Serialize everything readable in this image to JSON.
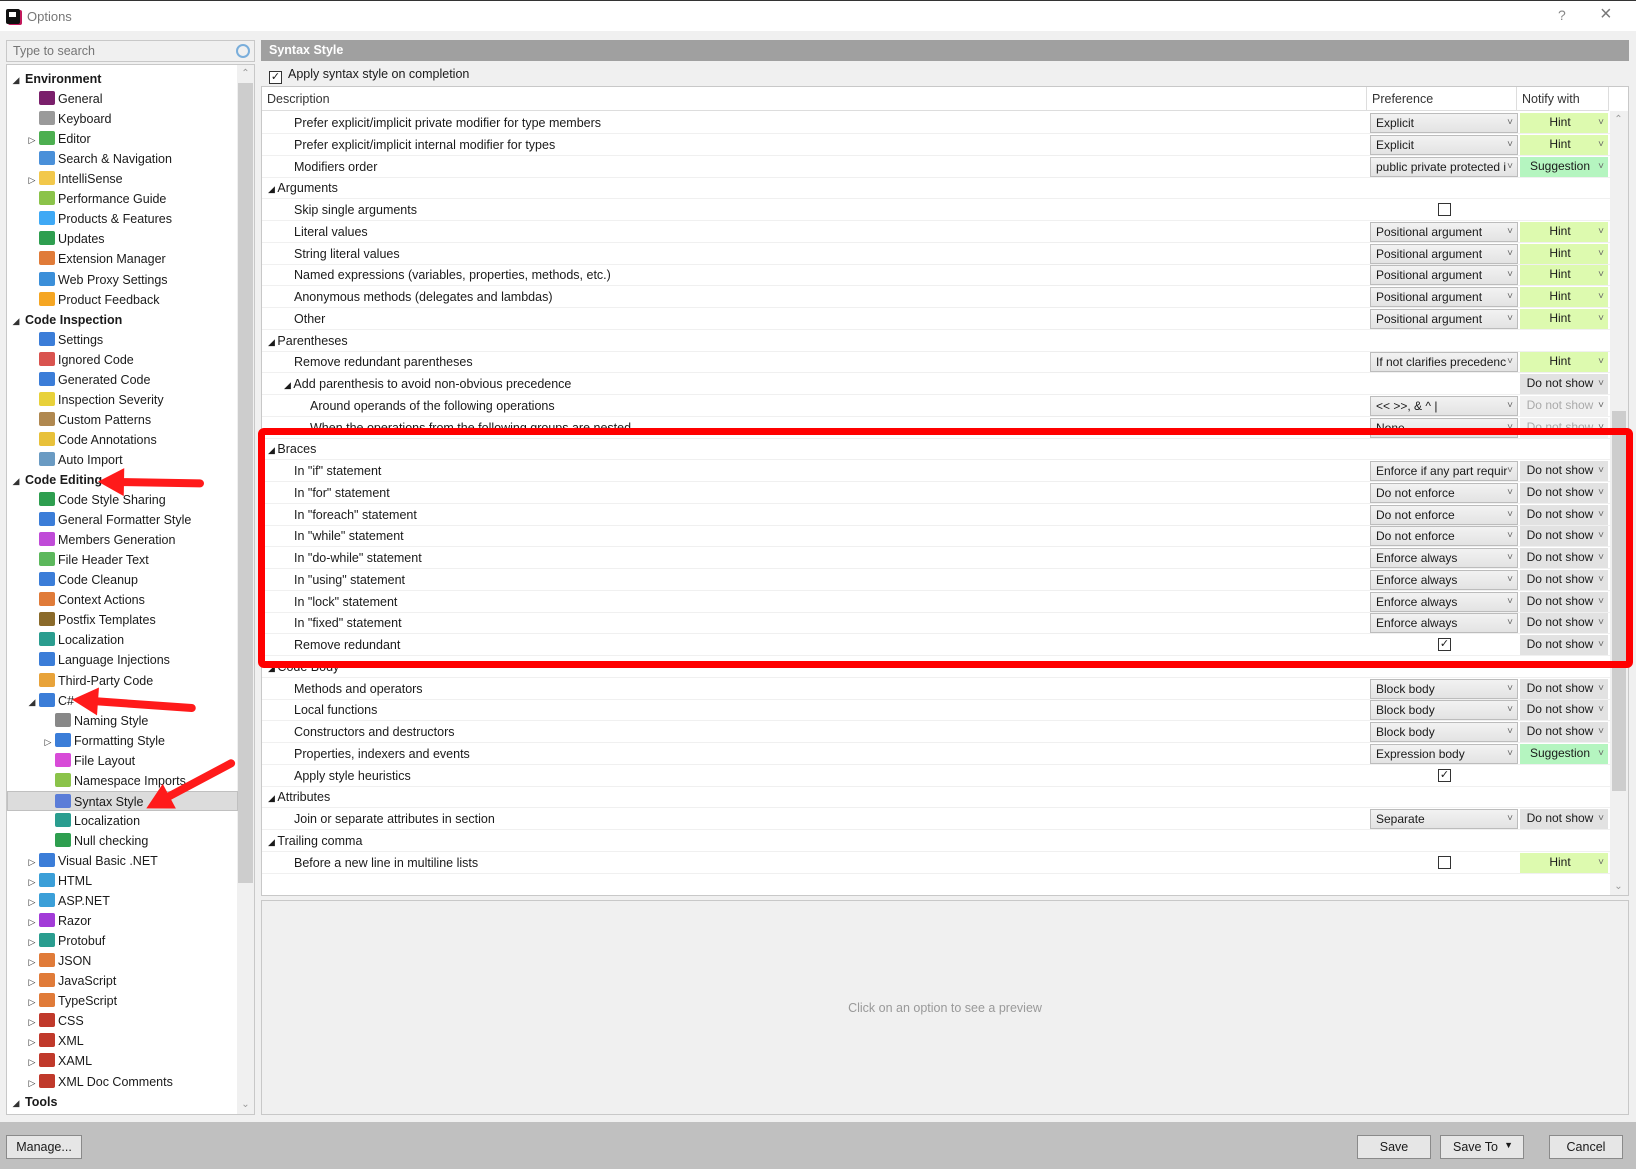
{
  "window": {
    "title": "Options",
    "help_label": "?",
    "close_label": "×"
  },
  "search": {
    "placeholder": "Type to search"
  },
  "tree": [
    {
      "label": "Environment",
      "level": 0,
      "category": true,
      "expander": "expanded"
    },
    {
      "label": "General",
      "level": 1,
      "icon": "resharper-icon",
      "color": "#7a1f6b"
    },
    {
      "label": "Keyboard",
      "level": 1,
      "icon": "keyboard-icon",
      "color": "#9a9a9a"
    },
    {
      "label": "Editor",
      "level": 1,
      "icon": "pencil-icon",
      "color": "#4caf50",
      "expander": "collapsed"
    },
    {
      "label": "Search & Navigation",
      "level": 1,
      "icon": "magnifier-icon",
      "color": "#4a90d9"
    },
    {
      "label": "IntelliSense",
      "level": 1,
      "icon": "lightbulb-icon",
      "color": "#f2c84b",
      "expander": "collapsed"
    },
    {
      "label": "Performance Guide",
      "level": 1,
      "icon": "snail-icon",
      "color": "#8bc34a"
    },
    {
      "label": "Products & Features",
      "level": 1,
      "icon": "blocks-icon",
      "color": "#3fa9f5"
    },
    {
      "label": "Updates",
      "level": 1,
      "icon": "download-icon",
      "color": "#2e9e4f"
    },
    {
      "label": "Extension Manager",
      "level": 1,
      "icon": "extension-icon",
      "color": "#e07b39"
    },
    {
      "label": "Web Proxy Settings",
      "level": 1,
      "icon": "globe-plug-icon",
      "color": "#3b8fd9"
    },
    {
      "label": "Product Feedback",
      "level": 1,
      "icon": "envelope-icon",
      "color": "#f5a623"
    },
    {
      "label": "Code Inspection",
      "level": 0,
      "category": true,
      "expander": "expanded"
    },
    {
      "label": "Settings",
      "level": 1,
      "icon": "inspector-icon",
      "color": "#3b7dd8"
    },
    {
      "label": "Ignored Code",
      "level": 1,
      "icon": "ignored-icon",
      "color": "#d9534f"
    },
    {
      "label": "Generated Code",
      "level": 1,
      "icon": "generated-icon",
      "color": "#3b7dd8"
    },
    {
      "label": "Inspection Severity",
      "level": 1,
      "icon": "severity-icon",
      "color": "#e8d13a"
    },
    {
      "label": "Custom Patterns",
      "level": 1,
      "icon": "patterns-icon",
      "color": "#b08850"
    },
    {
      "label": "Code Annotations",
      "level": 1,
      "icon": "annotations-icon",
      "color": "#e8c13a"
    },
    {
      "label": "Auto Import",
      "level": 1,
      "icon": "funnel-icon",
      "color": "#6a9bc3"
    },
    {
      "label": "Code Editing",
      "level": 0,
      "category": true,
      "expander": "expanded"
    },
    {
      "label": "Code Style Sharing",
      "level": 1,
      "icon": "share-icon",
      "color": "#2e9e4f"
    },
    {
      "label": "General Formatter Style",
      "level": 1,
      "icon": "formatter-icon",
      "color": "#3b7dd8"
    },
    {
      "label": "Members Generation",
      "level": 1,
      "icon": "members-icon",
      "color": "#c04bd8"
    },
    {
      "label": "File Header Text",
      "level": 1,
      "icon": "file-header-icon",
      "color": "#5cb85c"
    },
    {
      "label": "Code Cleanup",
      "level": 1,
      "icon": "broom-icon",
      "color": "#3b7dd8"
    },
    {
      "label": "Context Actions",
      "level": 1,
      "icon": "hammer-icon",
      "color": "#e07b39"
    },
    {
      "label": "Postfix Templates",
      "level": 1,
      "icon": "postfix-icon",
      "color": "#8a6a2a"
    },
    {
      "label": "Localization",
      "level": 1,
      "icon": "localization-icon",
      "color": "#2a9d8f"
    },
    {
      "label": "Language Injections",
      "level": 1,
      "icon": "syringe-icon",
      "color": "#3b7dd8"
    },
    {
      "label": "Third-Party Code",
      "level": 1,
      "icon": "books-icon",
      "color": "#e8a33a"
    },
    {
      "label": "C#",
      "level": 1,
      "icon": "csharp-icon",
      "color": "#3b7dd8",
      "expander": "expanded"
    },
    {
      "label": "Naming Style",
      "level": 2,
      "icon": "naming-icon",
      "color": "#888888"
    },
    {
      "label": "Formatting Style",
      "level": 2,
      "icon": "formatter-icon",
      "color": "#3b7dd8",
      "expander": "collapsed"
    },
    {
      "label": "File Layout",
      "level": 2,
      "icon": "file-layout-icon",
      "color": "#d84bd8"
    },
    {
      "label": "Namespace Imports",
      "level": 2,
      "icon": "namespace-icon",
      "color": "#8bc34a"
    },
    {
      "label": "Syntax Style",
      "level": 2,
      "icon": "syntax-style-icon",
      "color": "#5b7dd8",
      "selected": true
    },
    {
      "label": "Localization",
      "level": 2,
      "icon": "localization-icon",
      "color": "#2a9d8f"
    },
    {
      "label": "Null checking",
      "level": 2,
      "icon": "shield-check-icon",
      "color": "#2e9e4f"
    },
    {
      "label": "Visual Basic .NET",
      "level": 1,
      "icon": "vb-icon",
      "color": "#3b7dd8",
      "expander": "collapsed"
    },
    {
      "label": "HTML",
      "level": 1,
      "icon": "html-file-icon",
      "color": "#3b9fd8",
      "expander": "collapsed"
    },
    {
      "label": "ASP.NET",
      "level": 1,
      "icon": "asp-file-icon",
      "color": "#3b9fd8",
      "expander": "collapsed"
    },
    {
      "label": "Razor",
      "level": 1,
      "icon": "razor-file-icon",
      "color": "#a23bd8",
      "expander": "collapsed"
    },
    {
      "label": "Protobuf",
      "level": 1,
      "icon": "proto-file-icon",
      "color": "#2a9d8f",
      "expander": "collapsed"
    },
    {
      "label": "JSON",
      "level": 1,
      "icon": "json-file-icon",
      "color": "#e07b39",
      "expander": "collapsed"
    },
    {
      "label": "JavaScript",
      "level": 1,
      "icon": "js-file-icon",
      "color": "#e07b39",
      "expander": "collapsed"
    },
    {
      "label": "TypeScript",
      "level": 1,
      "icon": "ts-file-icon",
      "color": "#e07b39",
      "expander": "collapsed"
    },
    {
      "label": "CSS",
      "level": 1,
      "icon": "css-file-icon",
      "color": "#c0392b",
      "expander": "collapsed"
    },
    {
      "label": "XML",
      "level": 1,
      "icon": "xml-file-icon",
      "color": "#c0392b",
      "expander": "collapsed"
    },
    {
      "label": "XAML",
      "level": 1,
      "icon": "xaml-file-icon",
      "color": "#c0392b",
      "expander": "collapsed"
    },
    {
      "label": "XML Doc Comments",
      "level": 1,
      "icon": "xml-file-icon",
      "color": "#c0392b",
      "expander": "collapsed"
    },
    {
      "label": "Tools",
      "level": 0,
      "category": true,
      "expander": "expanded"
    }
  ],
  "page": {
    "section_title": "Syntax Style",
    "apply_label": "Apply syntax style on completion",
    "apply_checked": true,
    "columns": {
      "description": "Description",
      "preference": "Preference",
      "notify": "Notify with"
    },
    "preview_text": "Click on an option to see a preview"
  },
  "rows": [
    {
      "type": "item",
      "indent": 1,
      "label": "Prefer explicit/implicit private modifier for type members",
      "pref": "Explicit",
      "notify": "Hint"
    },
    {
      "type": "item",
      "indent": 1,
      "label": "Prefer explicit/implicit internal modifier for types",
      "pref": "Explicit",
      "notify": "Hint"
    },
    {
      "type": "item",
      "indent": 1,
      "label": "Modifiers order",
      "pref": "public private protected i",
      "notify": "Suggestion"
    },
    {
      "type": "group",
      "indent": 0,
      "label": "Arguments"
    },
    {
      "type": "item",
      "indent": 1,
      "label": "Skip single arguments",
      "check": false
    },
    {
      "type": "item",
      "indent": 1,
      "label": "Literal values",
      "pref": "Positional argument",
      "notify": "Hint"
    },
    {
      "type": "item",
      "indent": 1,
      "label": "String literal values",
      "pref": "Positional argument",
      "notify": "Hint"
    },
    {
      "type": "item",
      "indent": 1,
      "label": "Named expressions (variables, properties, methods, etc.)",
      "pref": "Positional argument",
      "notify": "Hint"
    },
    {
      "type": "item",
      "indent": 1,
      "label": "Anonymous methods (delegates and lambdas)",
      "pref": "Positional argument",
      "notify": "Hint"
    },
    {
      "type": "item",
      "indent": 1,
      "label": "Other",
      "pref": "Positional argument",
      "notify": "Hint"
    },
    {
      "type": "group",
      "indent": 0,
      "label": "Parentheses"
    },
    {
      "type": "item",
      "indent": 1,
      "label": "Remove redundant parentheses",
      "pref": "If not clarifies precedenc",
      "notify": "Hint"
    },
    {
      "type": "subgroup",
      "indent": 1,
      "label": "Add parenthesis to avoid non-obvious precedence",
      "notify": "Do not show"
    },
    {
      "type": "item",
      "indent": 2,
      "label": "Around operands of the following operations",
      "pref": "<<  >>, &  ^  |",
      "notify": "Do not show",
      "dim": true
    },
    {
      "type": "item",
      "indent": 2,
      "label": "When the operations from the following groups are nested",
      "pref": "None",
      "notify": "Do not show",
      "dim": true
    },
    {
      "type": "group",
      "indent": 0,
      "label": "Braces"
    },
    {
      "type": "item",
      "indent": 1,
      "label": "In \"if\" statement",
      "pref": "Enforce if any part requir",
      "notify": "Do not show"
    },
    {
      "type": "item",
      "indent": 1,
      "label": "In \"for\" statement",
      "pref": "Do not enforce",
      "notify": "Do not show"
    },
    {
      "type": "item",
      "indent": 1,
      "label": "In \"foreach\" statement",
      "pref": "Do not enforce",
      "notify": "Do not show"
    },
    {
      "type": "item",
      "indent": 1,
      "label": "In \"while\" statement",
      "pref": "Do not enforce",
      "notify": "Do not show"
    },
    {
      "type": "item",
      "indent": 1,
      "label": "In \"do-while\" statement",
      "pref": "Enforce always",
      "notify": "Do not show"
    },
    {
      "type": "item",
      "indent": 1,
      "label": "In \"using\" statement",
      "pref": "Enforce always",
      "notify": "Do not show"
    },
    {
      "type": "item",
      "indent": 1,
      "label": "In \"lock\" statement",
      "pref": "Enforce always",
      "notify": "Do not show"
    },
    {
      "type": "item",
      "indent": 1,
      "label": "In \"fixed\" statement",
      "pref": "Enforce always",
      "notify": "Do not show"
    },
    {
      "type": "item",
      "indent": 1,
      "label": "Remove redundant",
      "check": true,
      "notify": "Do not show"
    },
    {
      "type": "group",
      "indent": 0,
      "label": "Code Body"
    },
    {
      "type": "item",
      "indent": 1,
      "label": "Methods and operators",
      "pref": "Block body",
      "notify": "Do not show"
    },
    {
      "type": "item",
      "indent": 1,
      "label": "Local functions",
      "pref": "Block body",
      "notify": "Do not show"
    },
    {
      "type": "item",
      "indent": 1,
      "label": "Constructors and destructors",
      "pref": "Block body",
      "notify": "Do not show"
    },
    {
      "type": "item",
      "indent": 1,
      "label": "Properties, indexers and events",
      "pref": "Expression body",
      "notify": "Suggestion"
    },
    {
      "type": "item",
      "indent": 1,
      "label": "Apply style heuristics",
      "check": true
    },
    {
      "type": "group",
      "indent": 0,
      "label": "Attributes"
    },
    {
      "type": "item",
      "indent": 1,
      "label": "Join or separate attributes in section",
      "pref": "Separate",
      "notify": "Do not show"
    },
    {
      "type": "group",
      "indent": 0,
      "label": "Trailing comma"
    },
    {
      "type": "item",
      "indent": 1,
      "label": "Before a new line in multiline lists",
      "check": false,
      "notify": "Hint"
    }
  ],
  "footer": {
    "manage_label": "Manage...",
    "save_label": "Save",
    "save_to_label": "Save To",
    "cancel_label": "Cancel"
  },
  "colors": {
    "hint": "#ddfaaf",
    "suggestion": "#b5f5c0",
    "do_not_show": "#e2e2e2",
    "highlight": "#ff0000"
  }
}
